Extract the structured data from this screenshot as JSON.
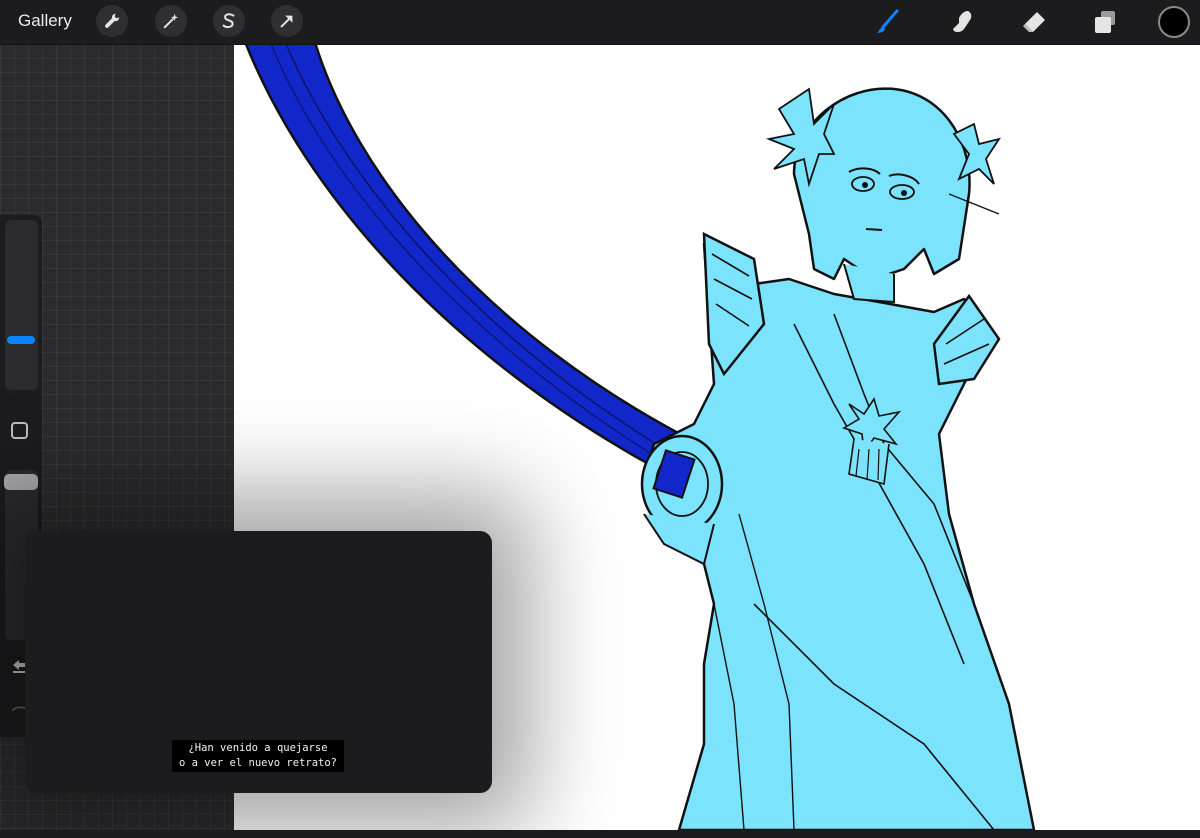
{
  "app": {
    "gallery_label": "Gallery"
  },
  "toolbar": {
    "left_tools": [
      {
        "name": "actions",
        "icon": "wrench-icon"
      },
      {
        "name": "adjustments",
        "icon": "magic-wand-icon"
      },
      {
        "name": "selection",
        "icon": "selection-s-icon"
      },
      {
        "name": "transform",
        "icon": "arrow-cursor-icon"
      }
    ],
    "right_tools": [
      {
        "name": "brush",
        "icon": "brush-icon",
        "active": true
      },
      {
        "name": "smudge",
        "icon": "smudge-finger-icon",
        "active": false
      },
      {
        "name": "eraser",
        "icon": "eraser-icon",
        "active": false
      },
      {
        "name": "layers",
        "icon": "layers-icon",
        "active": false
      }
    ],
    "current_color": "#000000",
    "active_color": "#0a84ff"
  },
  "sidebar": {
    "brush_size_icon": "size-slider-handle",
    "modify_icon": "modify-square-icon",
    "opacity_icon": "opacity-slider-handle",
    "undo_icon": "undo-arrow-icon",
    "redo_icon": "redo-arrow-icon"
  },
  "canvas": {
    "background": "#ffffff",
    "figure_fill": "#7ce3fd",
    "sword_fill": "#1227c9",
    "line_color": "#111111"
  },
  "video": {
    "subtitle_line1": "¿Han venido a quejarse",
    "subtitle_line2": "o a ver el nuevo retrato?"
  }
}
